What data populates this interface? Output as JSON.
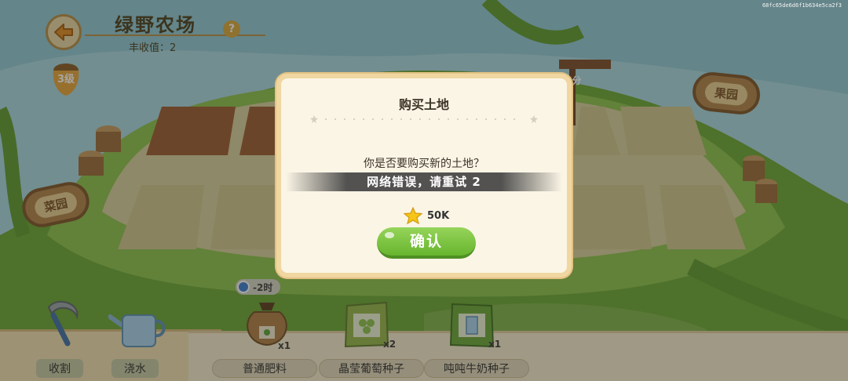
{
  "header": {
    "title": "绿野农场",
    "harvest_label": "丰收值：2",
    "help": "?"
  },
  "level": "3级",
  "signs": {
    "vegetable": "菜园",
    "fruit": "果园"
  },
  "signpost_timer": "7分",
  "toolbar": {
    "tools": [
      {
        "label": "收割",
        "icon": "sickle-icon"
      },
      {
        "label": "浇水",
        "icon": "watering-can-icon"
      }
    ],
    "boost_badge": "-2时",
    "items": [
      {
        "label": "普通肥料",
        "qty": "x1",
        "icon": "fertilizer-bag-icon"
      },
      {
        "label": "晶莹葡萄种子",
        "qty": "x2",
        "icon": "grape-seed-pack-icon"
      },
      {
        "label": "吨吨牛奶种子",
        "qty": "x1",
        "icon": "milk-seed-pack-icon"
      }
    ]
  },
  "dialog": {
    "title": "购买土地",
    "question": "你是否要购买新的土地？",
    "toast": "网络错误，请重试 2",
    "price": "50K",
    "confirm": "确认"
  },
  "watermark": "68fc65de6d6f1b634e5ca2f3",
  "colors": {
    "accent_green": "#67b52e",
    "dialog_bg": "#fbf5e6",
    "dialog_border": "#f0d6a0"
  }
}
